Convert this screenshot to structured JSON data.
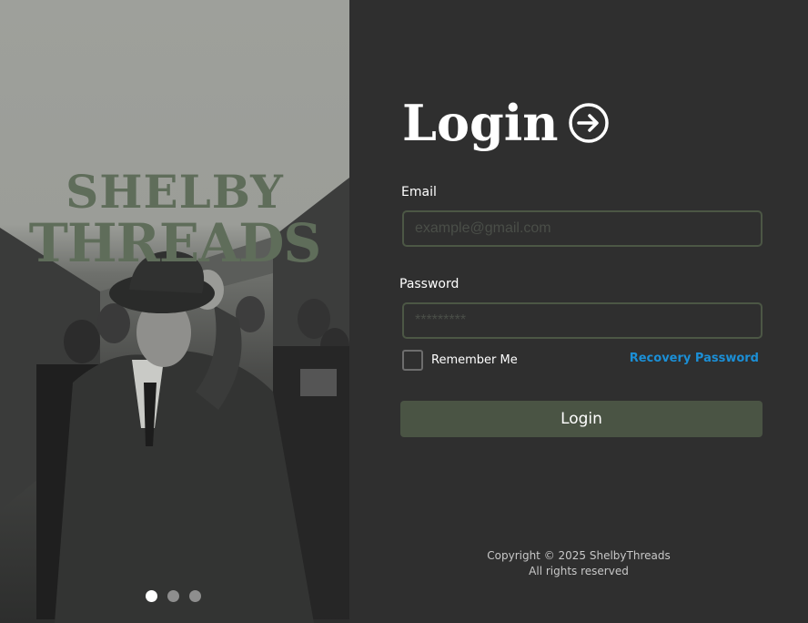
{
  "hero": {
    "brand_line1": "SHELBY",
    "brand_line2": "THREADS",
    "carousel": {
      "total": 3,
      "active": 1
    }
  },
  "form": {
    "title": "Login",
    "title_icon": "login-arrow-icon",
    "email_label": "Email",
    "email_placeholder": "example@gmail.com",
    "email_value": "",
    "password_label": "Password",
    "password_placeholder": "*********",
    "password_value": "",
    "remember_label": "Remember Me",
    "remember_checked": false,
    "recovery_label": "Recovery Password",
    "submit_label": "Login"
  },
  "footer": {
    "copyright": "Copyright © 2025 ShelbyThreads",
    "rights": "All rights reserved"
  },
  "colors": {
    "background": "#2f2f2f",
    "accent": "#4a5444",
    "field_border": "#4c5745",
    "link": "#1b8fd6",
    "brand_text": "#5f6d5a"
  }
}
